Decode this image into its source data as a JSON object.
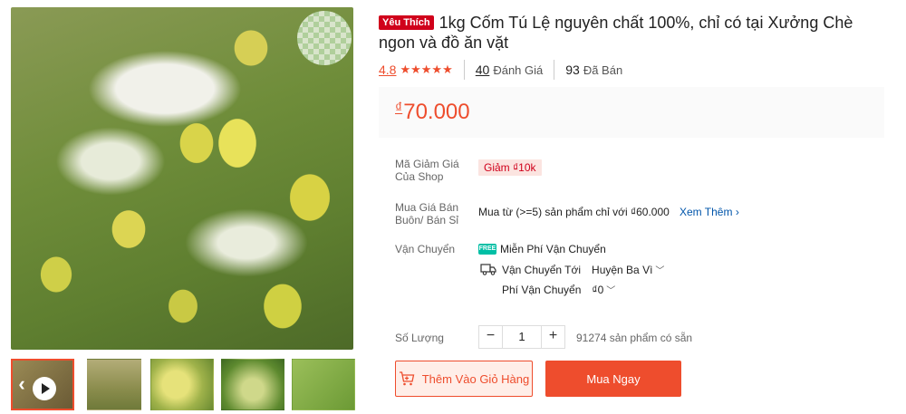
{
  "gallery": {
    "thumbnails": [
      "video",
      "package",
      "dish-1",
      "dish-2",
      "dish-3"
    ],
    "play_icon": "play-icon",
    "prev_icon": "chevron-left-icon",
    "next_icon": "chevron-right-icon"
  },
  "product": {
    "badge": "Yêu Thích",
    "title": "1kg Cốm Tú Lệ nguyên chất 100%, chỉ có tại Xưởng Chè ngon và đồ ăn vặt",
    "rating": "4.8",
    "stars": "★★★★★",
    "reviews_count": "40",
    "reviews_label": "Đánh Giá",
    "sold_count": "93",
    "sold_label": "Đã Bán",
    "currency": "₫",
    "price": "70.000"
  },
  "details": {
    "voucher_label": "Mã Giảm Giá Của Shop",
    "voucher_value": "Giảm ₫10k",
    "wholesale_label": "Mua Giá Bán Buôn/ Bán Sỉ",
    "wholesale_text": "Mua từ (>=5) sản phẩm chỉ với ₫60.000",
    "see_more": "Xem Thêm",
    "shipping_label": "Vận Chuyển",
    "free_shipping": "Miễn Phí Vận Chuyển",
    "ship_to_label": "Vận Chuyển Tới",
    "ship_to_value": "Huyện Ba Vì",
    "ship_fee_label": "Phí Vận Chuyển",
    "ship_fee_value": "₫0",
    "quantity_label": "Số Lượng",
    "quantity_value": "1",
    "minus": "−",
    "plus": "+",
    "stock_text": "91274 sản phẩm có sẵn"
  },
  "actions": {
    "add_to_cart": "Thêm Vào Giỏ Hàng",
    "buy_now": "Mua Ngay"
  },
  "colors": {
    "accent": "#ee4d2d",
    "badge": "#d0011b",
    "link": "#0055aa"
  }
}
